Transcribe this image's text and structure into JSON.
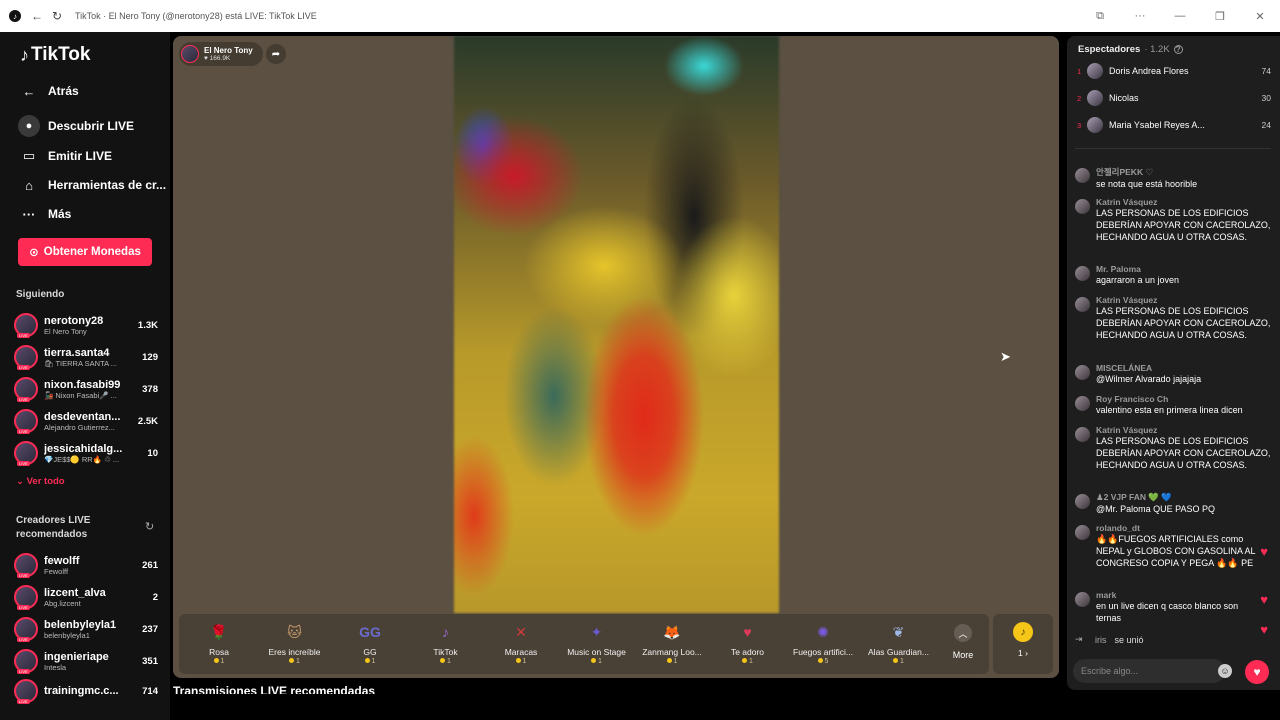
{
  "window": {
    "title": "TikTok · El Nero Tony (@nerotony28) está LIVE: TikTok LIVE"
  },
  "sidebar": {
    "logo": "TikTok",
    "nav": [
      {
        "label": "Atrás",
        "icon": "arrow-left-icon"
      },
      {
        "label": "Descubrir LIVE",
        "icon": "live-avatar-icon"
      },
      {
        "label": "Emitir LIVE",
        "icon": "video-camera-icon"
      },
      {
        "label": "Herramientas de cr...",
        "icon": "house-icon"
      },
      {
        "label": "Más",
        "icon": "more-dots-icon"
      }
    ],
    "coins_button": "Obtener Monedas",
    "following_title": "Siguiendo",
    "following": [
      {
        "name": "nerotony28",
        "sub": "El Nero Tony",
        "count": "1.3K"
      },
      {
        "name": "tierra.santa4",
        "sub": "🛍 TIERRA SANTA ...",
        "count": "129"
      },
      {
        "name": "nixon.fasabi99",
        "sub": "🚂 Nixon Fasabi🎤 ...",
        "count": "378"
      },
      {
        "name": "desdeventan...",
        "sub": "Alejandro Gutierrez...",
        "count": "2.5K"
      },
      {
        "name": "jessicahidalg...",
        "sub": "💎JE$$🟡 RR🔥 ♲ ...",
        "count": "10"
      }
    ],
    "see_all": "Ver todo",
    "recommended_title": "Creadores LIVE recomendados",
    "recommended": [
      {
        "name": "fewolff",
        "sub": "Fewolff",
        "count": "261"
      },
      {
        "name": "lizcent_alva",
        "sub": "Abg.lizcent",
        "count": "2"
      },
      {
        "name": "belenbyleyla1",
        "sub": "belenbyleyla1",
        "count": "237"
      },
      {
        "name": "ingenieriape",
        "sub": "Intesla",
        "count": "351"
      },
      {
        "name": "trainingmc.c...",
        "sub": "",
        "count": "714"
      }
    ]
  },
  "stage": {
    "host_name": "El Nero Tony",
    "host_likes": "♥ 166.9K",
    "gifts": [
      {
        "name": "Rosa",
        "cost": "1",
        "icon": "🌹",
        "color": "#c4232e"
      },
      {
        "name": "Eres increíble",
        "cost": "1",
        "icon": "🐱",
        "color": "#c79a6a"
      },
      {
        "name": "GG",
        "cost": "1",
        "icon": "GG",
        "color": "#6a6acf"
      },
      {
        "name": "TikTok",
        "cost": "1",
        "icon": "♪",
        "color": "#9a6ad0"
      },
      {
        "name": "Maracas",
        "cost": "1",
        "icon": "✕",
        "color": "#d03a3a"
      },
      {
        "name": "Music on Stage",
        "cost": "1",
        "icon": "✦",
        "color": "#6a5ad0"
      },
      {
        "name": "Zanmang Loo...",
        "cost": "1",
        "icon": "🦊",
        "color": "#e08aa0"
      },
      {
        "name": "Te adoro",
        "cost": "1",
        "icon": "♥",
        "color": "#e03a5a"
      },
      {
        "name": "Fuegos artifici...",
        "cost": "5",
        "icon": "✺",
        "color": "#7a5ae0"
      },
      {
        "name": "Alas Guardian...",
        "cost": "1",
        "icon": "❦",
        "color": "#a0b8e8"
      }
    ],
    "more_label": "More",
    "coin_label": "1 ›",
    "recommend_heading": "Transmisiones LIVE recomendadas"
  },
  "chat": {
    "viewers_label": "Espectadores",
    "viewers_count": "· 1.2K",
    "top_viewers": [
      {
        "rank": "1",
        "name": "Doris Andrea Flores",
        "score": "74"
      },
      {
        "rank": "2",
        "name": "Nicolas",
        "score": "30"
      },
      {
        "rank": "3",
        "name": "Maria Ysabel Reyes A...",
        "score": "24"
      }
    ],
    "messages": [
      {
        "user": "안젤리PEKK ♡",
        "text": "se nota que está hoorible"
      },
      {
        "user": "Katrin Vásquez",
        "text": "LAS PERSONAS DE LOS EDIFICIOS DEBERÍAN APOYAR CON CACEROLAZO, HECHANDO AGUA U OTRA COSAS."
      },
      {
        "user": "Mr. Paloma",
        "text": "agarraron a un joven"
      },
      {
        "user": "Katrin Vásquez",
        "text": "LAS PERSONAS DE LOS EDIFICIOS DEBERÍAN APOYAR CON CACEROLAZO, HECHANDO AGUA U OTRA COSAS."
      },
      {
        "user": "MISCELÁNEA",
        "text": "@Wilmer Alvarado jajajaja"
      },
      {
        "user": "Roy Francisco Ch",
        "text": "valentino esta en primera linea dicen"
      },
      {
        "user": "Katrin Vásquez",
        "text": "LAS PERSONAS DE LOS EDIFICIOS DEBERÍAN APOYAR CON CACEROLAZO, HECHANDO AGUA U OTRA COSAS."
      },
      {
        "user": "♟2 VJP FAN 💚 💙",
        "text": "@Mr. Paloma QUE PASO PQ"
      },
      {
        "user": "rolando_dt",
        "text": "🔥🔥FUEGOS ARTIFICIALES como NEPAL y GLOBOS CON GASOLINA AL CONGRESO COPIA Y PEGA 🔥🔥 PE"
      },
      {
        "user": "mark",
        "text": "en un live dicen q casco blanco son ternas"
      }
    ],
    "join_user": "iris",
    "join_text": "se unió",
    "input_placeholder": "Escribe algo..."
  }
}
